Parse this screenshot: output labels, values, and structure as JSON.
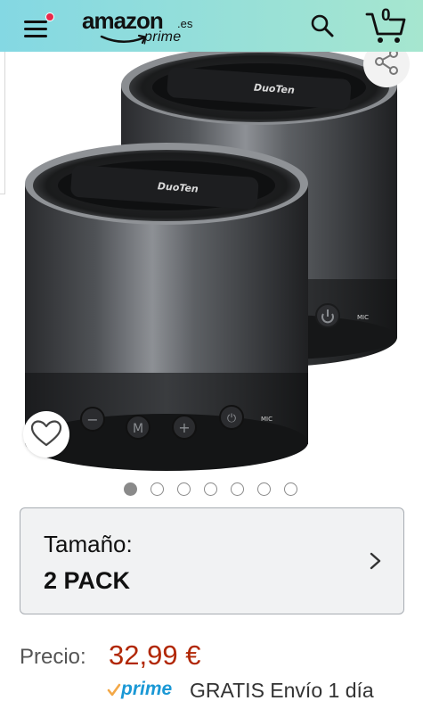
{
  "header": {
    "logo": {
      "brand": "amazon",
      "tld": ".es",
      "sub": "prime"
    },
    "cart_count": "0",
    "menu_has_notification": true,
    "colors": {
      "gradient_start": "#84d8e3",
      "gradient_end": "#a6e6cf"
    }
  },
  "gallery": {
    "image_product": "DuoTen",
    "speaker_buttons": [
      "−",
      "M",
      "+",
      "⏻"
    ],
    "speaker_mic_label": "MIC",
    "dots_total": 7,
    "dots_active": 1
  },
  "variation": {
    "label": "Tamaño:",
    "value": "2 PACK"
  },
  "price": {
    "label": "Precio:",
    "value": "32,99 €",
    "color": "#b12704"
  },
  "shipping": {
    "prime_label": "prime",
    "text": "GRATIS Envío 1 día"
  },
  "icons": {
    "menu": "hamburger-menu-icon",
    "search": "search-icon",
    "cart": "cart-icon",
    "share": "share-icon",
    "wishlist": "heart-icon",
    "chevron": "chevron-right-icon"
  }
}
